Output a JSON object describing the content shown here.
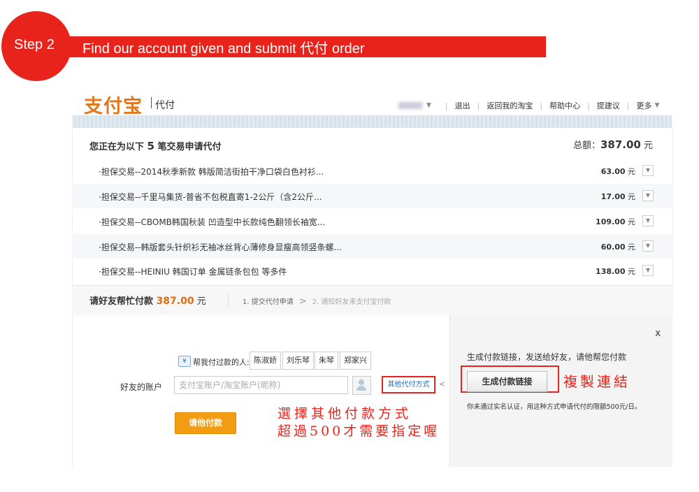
{
  "step": {
    "label": "Step 2",
    "title": "Find our account given and submit 代付 order"
  },
  "header": {
    "logo_text": "支付宝",
    "logo_sub": "代付",
    "nav": [
      "退出",
      "返回我的淘宝",
      "帮助中心",
      "提建议",
      "更多"
    ]
  },
  "order": {
    "title_prefix": "您正在为以下 ",
    "count": "5",
    "title_suffix": " 笔交易申请代付",
    "total_label": "总额：",
    "total_value": "387.00",
    "total_unit": " 元",
    "items": [
      {
        "desc": "·担保交易--2014秋季新款 韩版简洁街拍干净口袋白色衬衫...",
        "amount": "63.00",
        "unit": " 元"
      },
      {
        "desc": "·担保交易--千里马集货-普省不包税直寄1-2公斤（含2公斤...",
        "amount": "17.00",
        "unit": " 元"
      },
      {
        "desc": "·担保交易--CBOMB韩国秋装 凹造型中长款纯色翻领长袖宽...",
        "amount": "109.00",
        "unit": " 元"
      },
      {
        "desc": "·担保交易--韩版套头针织衫无袖冰丝背心薄修身显瘦高领竖条螺...",
        "amount": "60.00",
        "unit": " 元"
      },
      {
        "desc": "·担保交易--HEINIU 韩国订单 金属链条包包 等多件",
        "amount": "138.00",
        "unit": " 元"
      }
    ]
  },
  "pay": {
    "label": "请好友帮忙付款 ",
    "amount": "387.00",
    "unit": " 元",
    "step1": "1. 提交代付申请",
    "arrow": ">",
    "step2": "2. 通知好友来支付宝付款"
  },
  "friend_form": {
    "helped_icon": "¥",
    "helped_label": "帮我付过款的人:",
    "friends": [
      "陈淑娇",
      "刘乐琴",
      "朱琴",
      "郑家兴"
    ],
    "account_label": "好友的账户",
    "account_placeholder": "支付宝账户/淘宝账户(昵称)",
    "other_method": "其他代付方式",
    "collapse": "<",
    "submit": "请他付款"
  },
  "link_panel": {
    "close": "x",
    "desc": "生成付款链接，发送给好友，请他帮您付款",
    "button": "生成付款链接",
    "note": "你未通过实名认证，用这种方式申请代付的限额500元/日。"
  },
  "annotations": {
    "copy_link": "複製連結",
    "choose_other": "選擇其他付款方式",
    "over_500": "超過500才需要指定喔"
  },
  "colors": {
    "brand_red": "#e8231b",
    "orange_button": "#f39c12",
    "amount_orange": "#e06d10",
    "link_blue": "#1e6ebc"
  }
}
